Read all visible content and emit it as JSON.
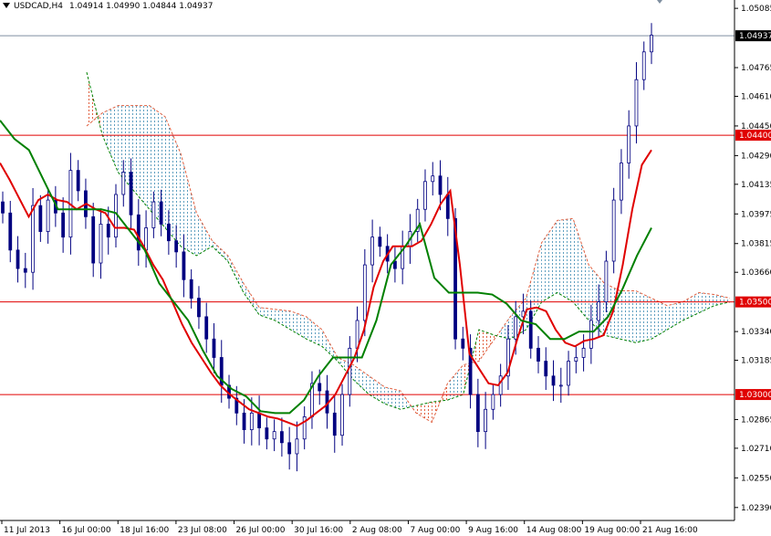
{
  "header": {
    "symbol": "USDCAD,H4",
    "ohlc": "1.04914 1.04990 1.04844 1.04937"
  },
  "current_price_label": "1.04937",
  "colors": {
    "background": "#ffffff",
    "axis": "#000000",
    "candle": "#000080",
    "tenkan": "#e00000",
    "kijun": "#008000",
    "cloud_bear": "#e06040",
    "cloud_bull": "#60a0c0",
    "level_line": "#e00000",
    "level_label_bg": "#e00000",
    "current_line": "#7f8fa0",
    "current_label_bg": "#000000"
  },
  "chart_data": {
    "type": "candlestick",
    "symbol": "USDCAD",
    "timeframe": "H4",
    "indicator": "Ichimoku",
    "x_tick_labels": [
      "11 Jul 2013",
      "16 Jul 00:00",
      "18 Jul 16:00",
      "23 Jul 08:00",
      "26 Jul 00:00",
      "30 Jul 16:00",
      "2 Aug 08:00",
      "7 Aug 00:00",
      "9 Aug 16:00",
      "14 Aug 08:00",
      "19 Aug 00:00",
      "21 Aug 16:00"
    ],
    "y_tick_labels": [
      "1.05085",
      "1.04765",
      "1.04610",
      "1.04450",
      "1.04290",
      "1.04135",
      "1.03975",
      "1.03815",
      "1.03660",
      "1.03340",
      "1.03185",
      "1.02865",
      "1.02710",
      "1.02550",
      "1.02390"
    ],
    "ylim": [
      1.0232,
      1.0513
    ],
    "horizontal_levels": [
      1.044,
      1.035,
      1.03
    ],
    "level_labels": [
      "1.04400",
      "1.03500",
      "1.03000"
    ],
    "current_price": 1.04937,
    "close": [
      1.0398,
      1.0378,
      1.0368,
      1.0366,
      1.0402,
      1.0388,
      1.0405,
      1.0398,
      1.0385,
      1.0421,
      1.041,
      1.0396,
      1.0371,
      1.0392,
      1.0385,
      1.0408,
      1.042,
      1.0397,
      1.0378,
      1.039,
      1.0404,
      1.0392,
      1.0383,
      1.0377,
      1.0362,
      1.0352,
      1.0342,
      1.033,
      1.032,
      1.0305,
      1.0298,
      1.029,
      1.0281,
      1.029,
      1.0282,
      1.0276,
      1.028,
      1.0274,
      1.0268,
      1.0276,
      1.0288,
      1.0306,
      1.0302,
      1.029,
      1.0278,
      1.03,
      1.0325,
      1.034,
      1.037,
      1.0385,
      1.038,
      1.0372,
      1.0368,
      1.038,
      1.0388,
      1.04,
      1.0415,
      1.0418,
      1.0408,
      1.0395,
      1.033,
      1.0325,
      1.03,
      1.028,
      1.0292,
      1.03,
      1.031,
      1.033,
      1.0342,
      1.0345,
      1.0325,
      1.0318,
      1.031,
      1.0305,
      1.0305,
      1.0318,
      1.032,
      1.0325,
      1.034,
      1.035,
      1.0372,
      1.0405,
      1.0425,
      1.0445,
      1.047,
      1.0485,
      1.0494
    ],
    "tenkan": [
      1.0425,
      1.0416,
      1.0406,
      1.0396,
      1.0405,
      1.0408,
      1.0405,
      1.0404,
      1.04,
      1.0403,
      1.04,
      1.0398,
      1.039,
      1.039,
      1.0389,
      1.038,
      1.037,
      1.0362,
      1.035,
      1.0338,
      1.0328,
      1.032,
      1.0312,
      1.0305,
      1.03,
      1.0296,
      1.0292,
      1.029,
      1.0288,
      1.0287,
      1.0285,
      1.0283,
      1.0286,
      1.029,
      1.0294,
      1.03,
      1.031,
      1.032,
      1.0335,
      1.0358,
      1.0372,
      1.038,
      1.038,
      1.038,
      1.0383,
      1.0392,
      1.0403,
      1.041,
      1.037,
      1.0322,
      1.0314,
      1.0306,
      1.0305,
      1.0312,
      1.033,
      1.0346,
      1.0347,
      1.0345,
      1.0335,
      1.0328,
      1.0326,
      1.0329,
      1.033,
      1.0332,
      1.0345,
      1.037,
      1.04,
      1.0424,
      1.0432
    ],
    "kijun": [
      1.0448,
      1.0438,
      1.0432,
      1.0416,
      1.04,
      1.04,
      1.04,
      1.04,
      1.0398,
      1.0388,
      1.0378,
      1.036,
      1.035,
      1.034,
      1.0324,
      1.031,
      1.0303,
      1.0299,
      1.0291,
      1.029,
      1.029,
      1.0297,
      1.031,
      1.032,
      1.032,
      1.032,
      1.034,
      1.037,
      1.038,
      1.0392,
      1.0363,
      1.0355,
      1.0355,
      1.0355,
      1.0354,
      1.0349,
      1.034,
      1.0338,
      1.033,
      1.033,
      1.0334,
      1.0334,
      1.0342,
      1.0357,
      1.0375,
      1.039
    ],
    "cloud_top": [
      1.0445,
      1.0452,
      1.0456,
      1.0456,
      1.0456,
      1.045,
      1.043,
      1.0398,
      1.0383,
      1.0375,
      1.036,
      1.0347,
      1.0346,
      1.0345,
      1.0342,
      1.0335,
      1.032,
      1.0316,
      1.031,
      1.0304,
      1.0302,
      1.029,
      1.0285,
      1.0306,
      1.0316,
      1.0318,
      1.033,
      1.0342,
      1.0352,
      1.0382,
      1.0394,
      1.0395,
      1.037,
      1.036,
      1.0356,
      1.0356,
      1.0352,
      1.0348,
      1.035,
      1.0355,
      1.0354,
      1.0352
    ],
    "cloud_bottom": [
      1.0474,
      1.044,
      1.042,
      1.041,
      1.04,
      1.039,
      1.038,
      1.0375,
      1.038,
      1.0372,
      1.0355,
      1.0343,
      1.034,
      1.0335,
      1.033,
      1.0326,
      1.0318,
      1.0308,
      1.03,
      1.0295,
      1.0292,
      1.0294,
      1.0296,
      1.0297,
      1.03,
      1.0335,
      1.0332,
      1.033,
      1.0335,
      1.035,
      1.0355,
      1.035,
      1.034,
      1.0332,
      1.033,
      1.0328,
      1.033,
      1.0335,
      1.034,
      1.0344,
      1.0348,
      1.035
    ]
  }
}
